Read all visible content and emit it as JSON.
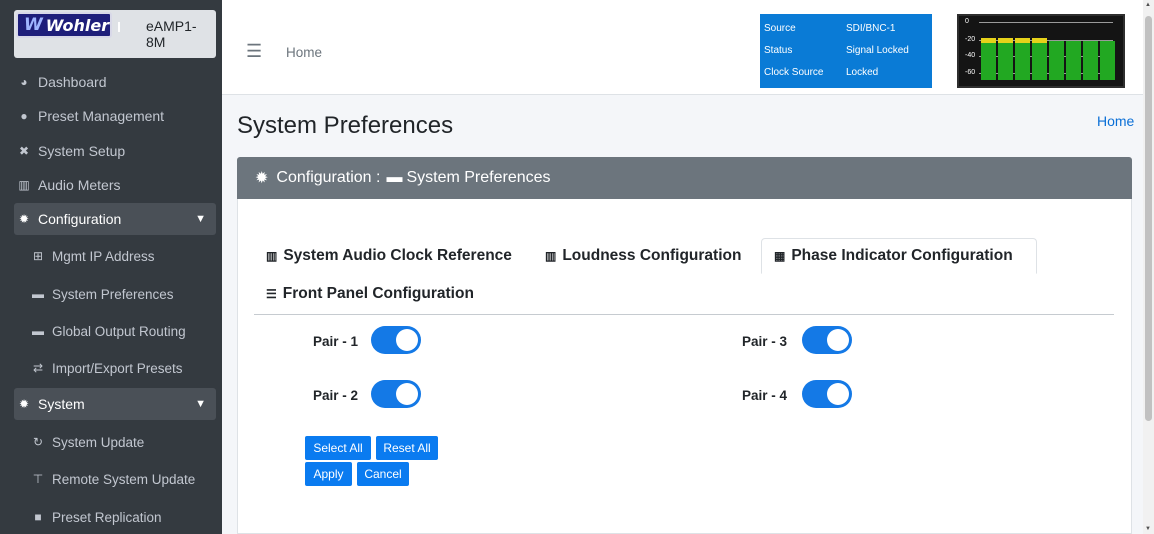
{
  "brand": {
    "logo_text": "Wohler",
    "model": "eAMP1-8M"
  },
  "sidebar": {
    "items": [
      {
        "label": "Dashboard",
        "icon": "tachometer-icon"
      },
      {
        "label": "Preset Management",
        "icon": "user-cog-icon"
      },
      {
        "label": "System Setup",
        "icon": "tools-icon"
      },
      {
        "label": "Audio Meters",
        "icon": "chart-bar-icon"
      },
      {
        "label": "Configuration",
        "icon": "gear-icon",
        "expanded": true
      },
      {
        "label": "Mgmt IP Address",
        "icon": "network-icon"
      },
      {
        "label": "System Preferences",
        "icon": "keyboard-icon"
      },
      {
        "label": "Global Output Routing",
        "icon": "keyboard-icon"
      },
      {
        "label": "Import/Export Presets",
        "icon": "exchange-icon"
      },
      {
        "label": "System",
        "icon": "cogs-icon",
        "expanded": true
      },
      {
        "label": "System Update",
        "icon": "sync-icon"
      },
      {
        "label": "Remote System Update",
        "icon": "network-wired-icon"
      },
      {
        "label": "Preset Replication",
        "icon": "copy-icon"
      }
    ]
  },
  "header": {
    "home": "Home",
    "status": [
      {
        "key": "Source",
        "value": "SDI/BNC-1"
      },
      {
        "key": "Status",
        "value": "Signal Locked"
      },
      {
        "key": "Clock Source",
        "value": "Locked"
      }
    ],
    "meter": {
      "ticks": [
        "0",
        "-20",
        "-40",
        "-60"
      ],
      "levels": [
        0.72,
        0.72,
        0.72,
        0.72,
        0.68,
        0.68,
        0.68,
        0.68
      ]
    }
  },
  "page": {
    "title": "System Preferences",
    "breadcrumb": "Home"
  },
  "card": {
    "title": "Configuration : ⌨ System Preferences",
    "title_prefix": "Configuration :",
    "title_suffix": "System Preferences"
  },
  "tabs": [
    {
      "label": "System Audio Clock Reference",
      "icon": "chart-bar-icon",
      "active": false
    },
    {
      "label": "Loudness Configuration",
      "icon": "chart-bar-icon",
      "active": false
    },
    {
      "label": "Phase Indicator Configuration",
      "icon": "grid-icon",
      "active": true
    },
    {
      "label": "Front Panel Configuration",
      "icon": "list-icon",
      "active": false
    }
  ],
  "pairs": [
    {
      "label": "Pair - 1",
      "on": true
    },
    {
      "label": "Pair - 3",
      "on": true
    },
    {
      "label": "Pair - 2",
      "on": true
    },
    {
      "label": "Pair - 4",
      "on": true
    }
  ],
  "buttons": {
    "select_all": "Select All",
    "reset_all": "Reset All",
    "apply": "Apply",
    "cancel": "Cancel"
  },
  "colors": {
    "sidebar_bg": "#343a40",
    "accent": "#0a7bf0",
    "status_box": "#0a7bd6",
    "card_header": "#6c757d"
  }
}
